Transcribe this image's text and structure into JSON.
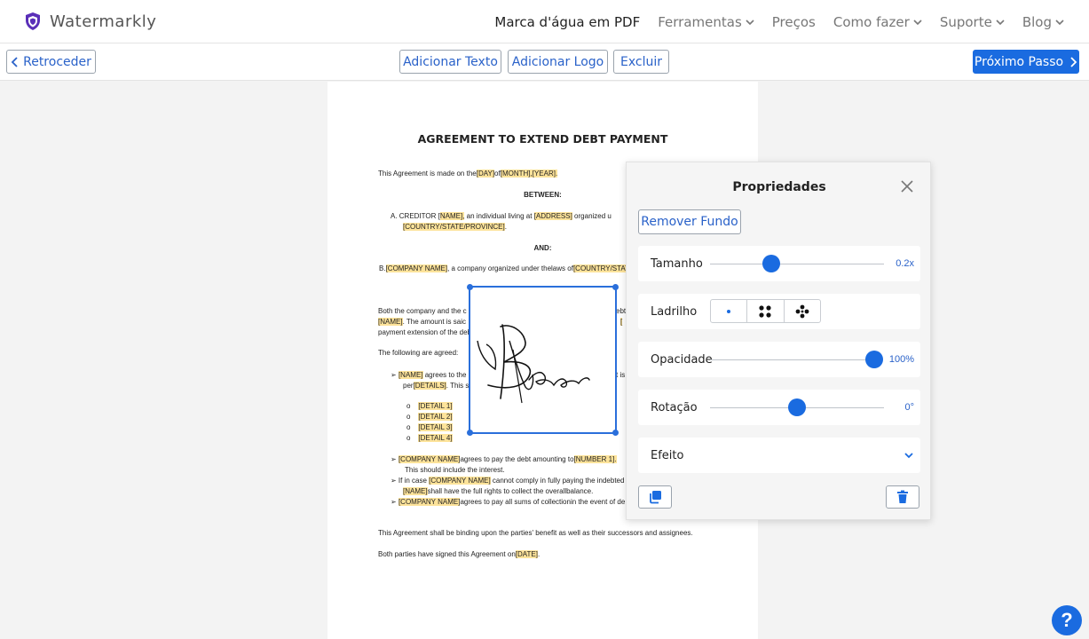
{
  "brand": {
    "name": "Watermarkly"
  },
  "nav": [
    {
      "label": "Marca d'água em PDF",
      "dropdown": false,
      "active": true
    },
    {
      "label": "Ferramentas",
      "dropdown": true
    },
    {
      "label": "Preços",
      "dropdown": false
    },
    {
      "label": "Como fazer",
      "dropdown": true
    },
    {
      "label": "Suporte",
      "dropdown": true
    },
    {
      "label": "Blog",
      "dropdown": true
    }
  ],
  "toolbar": {
    "back_label": "Retroceder",
    "add_text_label": "Adicionar Texto",
    "add_logo_label": "Adicionar Logo",
    "delete_label": "Excluir",
    "next_label": "Próximo Passo"
  },
  "document": {
    "title": "AGREEMENT TO EXTEND DEBT PAYMENT",
    "l1a": "This Agreement is made on the",
    "l1b": "[DAY]",
    "l1c": "of",
    "l1d": "[MONTH],",
    "l1e": "[YEAR].",
    "between": "BETWEEN:",
    "l2a": "A.    CREDITOR [",
    "l2b": "NAME],",
    "l2c": " an individual       living at    ",
    "l2d": "[ADDRESS]",
    "l2e": " organized u",
    "l3a": "[COUNTRY/STATE/PROVINCE]",
    "l3b": ".",
    "and": "AND:",
    "l4a": "B.",
    "l4b": "[COMPANY NAME]",
    "l4c": ", a company organized under thelaws of",
    "l4d": "[COUNTRY/STATE",
    "l5": "Both the company and the c",
    "l6a": "[NAME]",
    "l6b": ". The amount is saic",
    "l7": "payment extension of the deb",
    "l8": "The following are agreed:",
    "l9a": "➢    ",
    "l9b": "[NAME]",
    "l9c": " agrees to the",
    "l10a": "per",
    "l10b": "[DETAILS]",
    "l10c": ". This sh",
    "details": [
      "[DETAIL 1]",
      "[DETAIL 2]",
      "[DETAIL 3]",
      "[DETAIL 4]"
    ],
    "l11a": "➢    ",
    "l11b": "[COMPANY NAME]",
    "l11c": "agrees to pay the debt amounting to",
    "l11d": "[NUMBER 1].",
    "l12": "This should include the interest.",
    "l13a": "➢    If in case ",
    "l13b": "[COMPANY NAME]",
    "l13c": " cannot comply in fully paying the indebted",
    "l14a": "[NAME]",
    "l14b": "shall have the full rights to collect the overallbalance.",
    "l15a": "➢    ",
    "l15b": "[COMPANY NAME]",
    "l15c": "agrees to pay all sums of collectionin the event of de",
    "l16": "This Agreement shall be binding upon the parties' benefit as well as their successors and assignees.",
    "l17a": "Both parties have signed this Agreement on",
    "l17b": "[DATE]",
    "l17c": ".",
    "right_frag1": "[",
    "right_frag2": "t is",
    "right_frag3": "ebt"
  },
  "panel": {
    "title": "Propriedades",
    "remove_bg_label": "Remover Fundo",
    "size": {
      "label": "Tamanho",
      "value_text": "0.2x",
      "value": 0.2,
      "position": 0.35
    },
    "tile": {
      "label": "Ladrilho",
      "options": [
        "single",
        "grid-4",
        "diamond-5"
      ],
      "selected": "single"
    },
    "opacity": {
      "label": "Opacidade",
      "value_text": "100%",
      "value": 100
    },
    "rotation": {
      "label": "Rotação",
      "value_text": "0°",
      "value": 0,
      "position": 0.5
    },
    "effect": {
      "label": "Efeito"
    }
  },
  "help": {
    "label": "?"
  },
  "colors": {
    "accent": "#1a6be0",
    "highlight": "#fde39a",
    "link": "#2a62c9"
  }
}
